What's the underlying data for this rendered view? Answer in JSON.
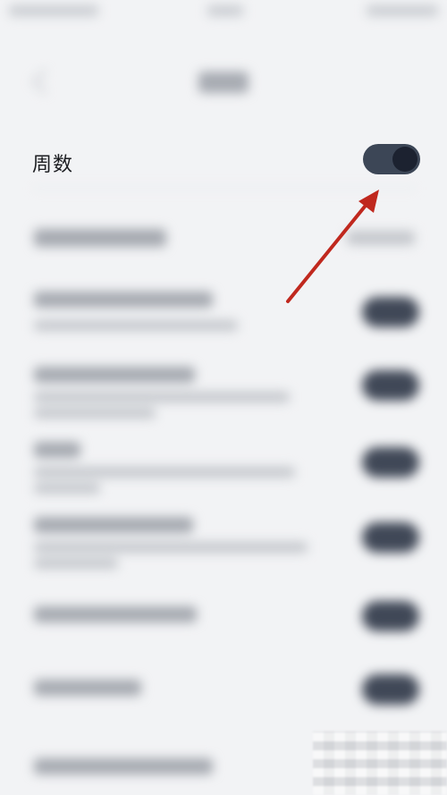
{
  "settings": {
    "week_number": {
      "label": "周数",
      "enabled": true
    }
  },
  "colors": {
    "toggle_on": "#3c4656",
    "toggle_knob": "#1c2230",
    "annotation_arrow": "#c0281e",
    "background": "#f2f3f5"
  },
  "icons": {
    "back": "back-arrow-icon",
    "annotation": "red-arrow-annotation-icon"
  }
}
